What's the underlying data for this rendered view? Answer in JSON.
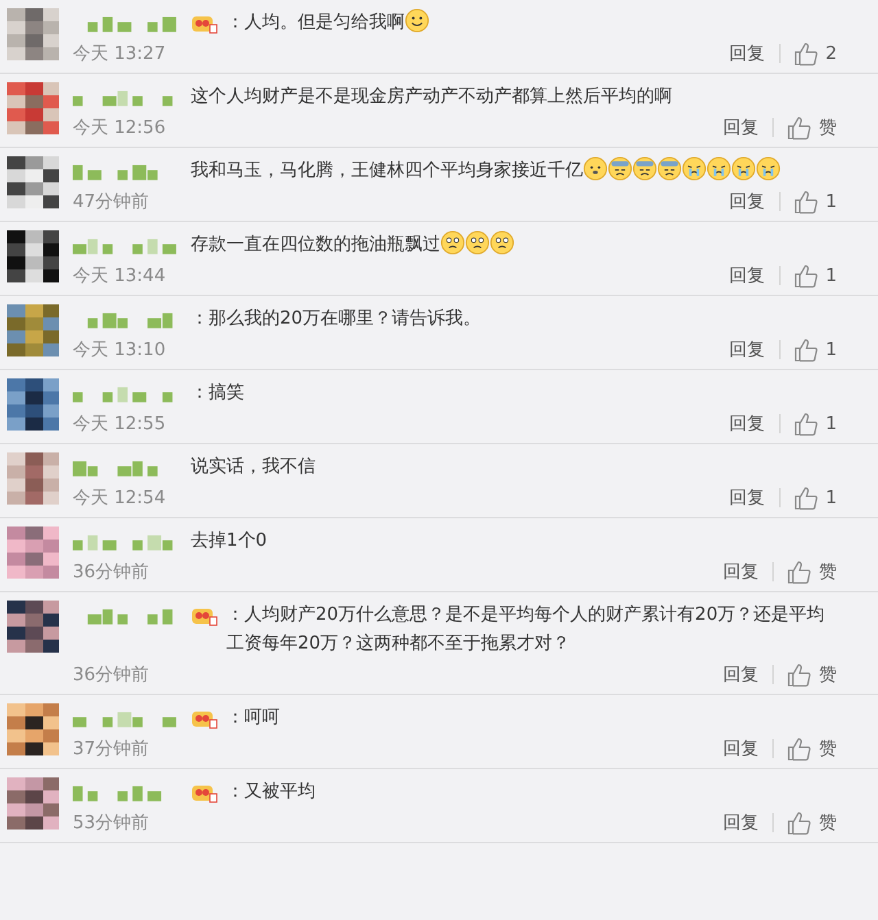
{
  "comments": [
    {
      "badge": true,
      "text": "：人均。但是匀给我啊",
      "emojis": [
        {
          "kind": "smile"
        }
      ],
      "time": "今天 13:27",
      "reply": "回复",
      "likes": "2"
    },
    {
      "badge": false,
      "text": "这个人均财产是不是现金房产动产不动产都算上然后平均的啊",
      "time": "今天 12:56",
      "reply": "回复",
      "likes": "赞"
    },
    {
      "badge": false,
      "text": "我和马玉，马化腾，王健林四个平均身家接近千亿",
      "emojis": [
        {
          "kind": "doge"
        },
        {
          "kind": "sweat"
        },
        {
          "kind": "sweat"
        },
        {
          "kind": "sweat"
        },
        {
          "kind": "cry"
        },
        {
          "kind": "cry"
        },
        {
          "kind": "cry"
        },
        {
          "kind": "cry"
        }
      ],
      "time": "47分钟前",
      "reply": "回复",
      "likes": "1"
    },
    {
      "badge": false,
      "text": "存款一直在四位数的拖油瓶飘过",
      "emojis": [
        {
          "kind": "sad"
        },
        {
          "kind": "sad"
        },
        {
          "kind": "sad"
        }
      ],
      "time": "今天 13:44",
      "reply": "回复",
      "likes": "1"
    },
    {
      "badge": false,
      "text": "：那么我的20万在哪里？请告诉我。",
      "time": "今天 13:10",
      "reply": "回复",
      "likes": "1"
    },
    {
      "badge": false,
      "text": "：搞笑",
      "time": "今天 12:55",
      "reply": "回复",
      "likes": "1"
    },
    {
      "badge": false,
      "text": "说实话，我不信",
      "time": "今天 12:54",
      "reply": "回复",
      "likes": "1"
    },
    {
      "badge": false,
      "text": "去掉1个0",
      "time": "36分钟前",
      "reply": "回复",
      "likes": "赞"
    },
    {
      "badge": true,
      "text": "：人均财产20万什么意思？是不是平均每个人的财产累计有20万？还是平均工资每年20万？这两种都不至于拖累才对？",
      "time": "36分钟前",
      "reply": "回复",
      "likes": "赞"
    },
    {
      "badge": true,
      "text": "：呵呵",
      "time": "37分钟前",
      "reply": "回复",
      "likes": "赞"
    },
    {
      "badge": true,
      "text": "：又被平均",
      "time": "53分钟前",
      "reply": "回复",
      "likes": "赞"
    }
  ]
}
